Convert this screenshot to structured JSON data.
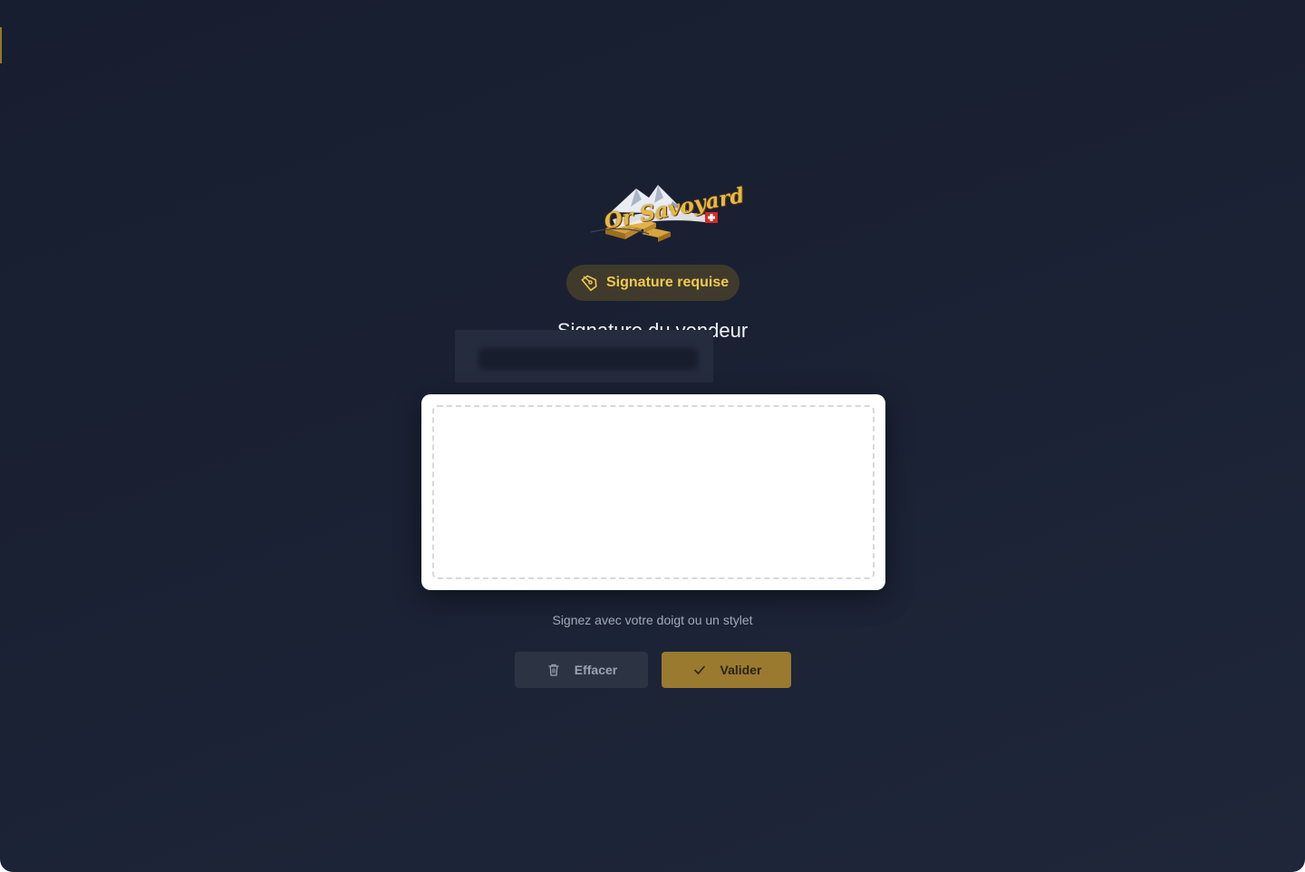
{
  "brand": {
    "logo_text": "Or Savoyard",
    "logo_icon": "mountain-gold-bars-logo"
  },
  "badge": {
    "label": "Signature requise",
    "icon": "pen-nib-icon",
    "color": "#f2c94c"
  },
  "heading": {
    "title": "Signature du vendeur"
  },
  "signature_pad": {
    "hint": "Signez avec votre doigt ou un stylet"
  },
  "actions": {
    "clear_label": "Effacer",
    "clear_icon": "trash-icon",
    "validate_label": "Valider",
    "validate_icon": "check-icon",
    "validate_color": "#9a7a2f"
  }
}
